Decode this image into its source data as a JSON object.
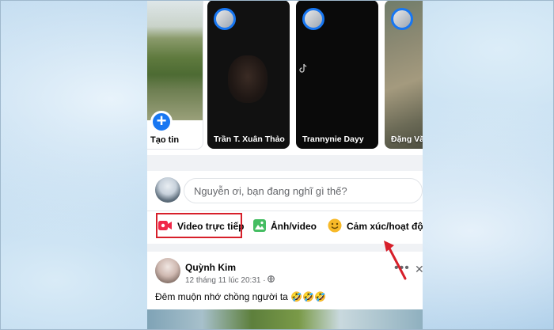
{
  "stories": {
    "create_label": "Tạo tin",
    "items": [
      {
        "name": "Trần T. Xuân Thảo"
      },
      {
        "name": "Trannynie Dayy"
      },
      {
        "name": "Đặng Văn"
      }
    ]
  },
  "composer": {
    "placeholder": "Nguyễn ơi, bạn đang nghĩ gì thế?",
    "actions": {
      "live": "Video trực tiếp",
      "photo": "Ảnh/video",
      "feeling": "Cảm xúc/hoạt động"
    }
  },
  "post": {
    "author": "Quỳnh Kim",
    "time": "12 tháng 11 lúc 20:31 ·",
    "text": "Đêm muộn nhớ chồng người ta 🤣🤣🤣",
    "more": "•••",
    "close": "✕"
  },
  "colors": {
    "accent": "#1877f2",
    "highlight": "#d71f2a",
    "live": "#f02849",
    "photo": "#45bd62",
    "feeling": "#f7b928"
  }
}
